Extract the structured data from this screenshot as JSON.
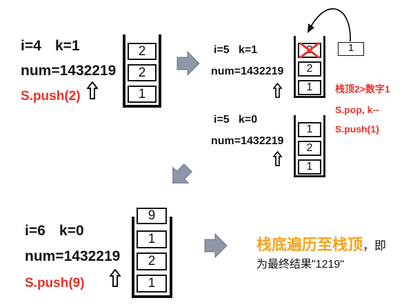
{
  "step1": {
    "i_label": "i=4",
    "k_label": "k=1",
    "num_label": "num=1432219",
    "push_label": "S.push(2)",
    "stack": [
      "2",
      "2",
      "1"
    ]
  },
  "step2a": {
    "i_label": "i=5",
    "k_label": "k=1",
    "num_label": "num=1432219",
    "stack": [
      "2",
      "2",
      "1"
    ],
    "popped_value": "1",
    "note_line1": "栈顶2>数字1",
    "note_line2": "S.pop, k--",
    "note_line3": "S.push(1)"
  },
  "step2b": {
    "i_label": "i=5",
    "k_label": "k=0",
    "num_label": "num=1432219",
    "stack": [
      "1",
      "2",
      "1"
    ]
  },
  "step3": {
    "i_label": "i=6",
    "k_label": "k=0",
    "num_label": "num=1432219",
    "push_label": "S.push(9)",
    "stack": [
      "9",
      "1",
      "2",
      "1"
    ]
  },
  "result": {
    "title": "栈底遍历至栈顶",
    "suffix": "，即",
    "line2": "为最终结果\"1219\""
  },
  "colors": {
    "red": "#e8322b",
    "orange": "#f5a31a",
    "arrow_gray": "#8e96a8"
  }
}
